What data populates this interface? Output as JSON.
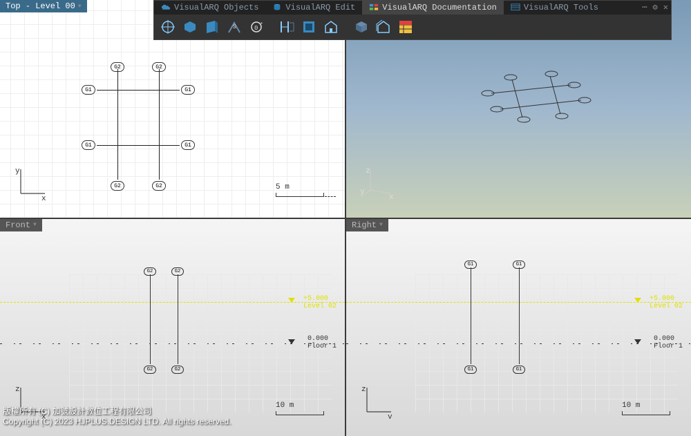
{
  "viewports": {
    "top": {
      "title": "Top - Level 00",
      "axes": [
        "x",
        "y"
      ],
      "scale": "5 m"
    },
    "persp": {
      "title": "",
      "axes": [
        "x",
        "y",
        "z"
      ]
    },
    "front": {
      "title": "Front",
      "axes": [
        "x",
        "z"
      ],
      "scale": "10 m"
    },
    "right": {
      "title": "Right",
      "axes": [
        "y",
        "z"
      ],
      "scale": "10 m"
    }
  },
  "grid_labels": {
    "g1": "G1",
    "g2": "G2"
  },
  "levels": {
    "level02": {
      "elev": "+5.000",
      "name": "Level 02"
    },
    "floor1": {
      "elev": "0.000",
      "name": "Floor 1"
    }
  },
  "tabs": [
    {
      "label": "VisualARQ Objects",
      "active": false
    },
    {
      "label": "VisualARQ Edit",
      "active": false
    },
    {
      "label": "VisualARQ Documentation",
      "active": true
    },
    {
      "label": "VisualARQ Tools",
      "active": false
    }
  ],
  "toolbar_icons": [
    "section-icon",
    "plan-view-icon",
    "section-view-icon",
    "section-attrs-icon",
    "level-icon",
    "dimension-icon",
    "opening-elev-icon",
    "space-icon",
    "hatch-icon",
    "layer-icon",
    "table-icon"
  ],
  "footer": {
    "line1": "版權所有 (C) 加號設計數位工程有限公司",
    "line2": "Copyright (C) 2023 HJPLUS.DESIGN LTD. All rights reserved."
  }
}
